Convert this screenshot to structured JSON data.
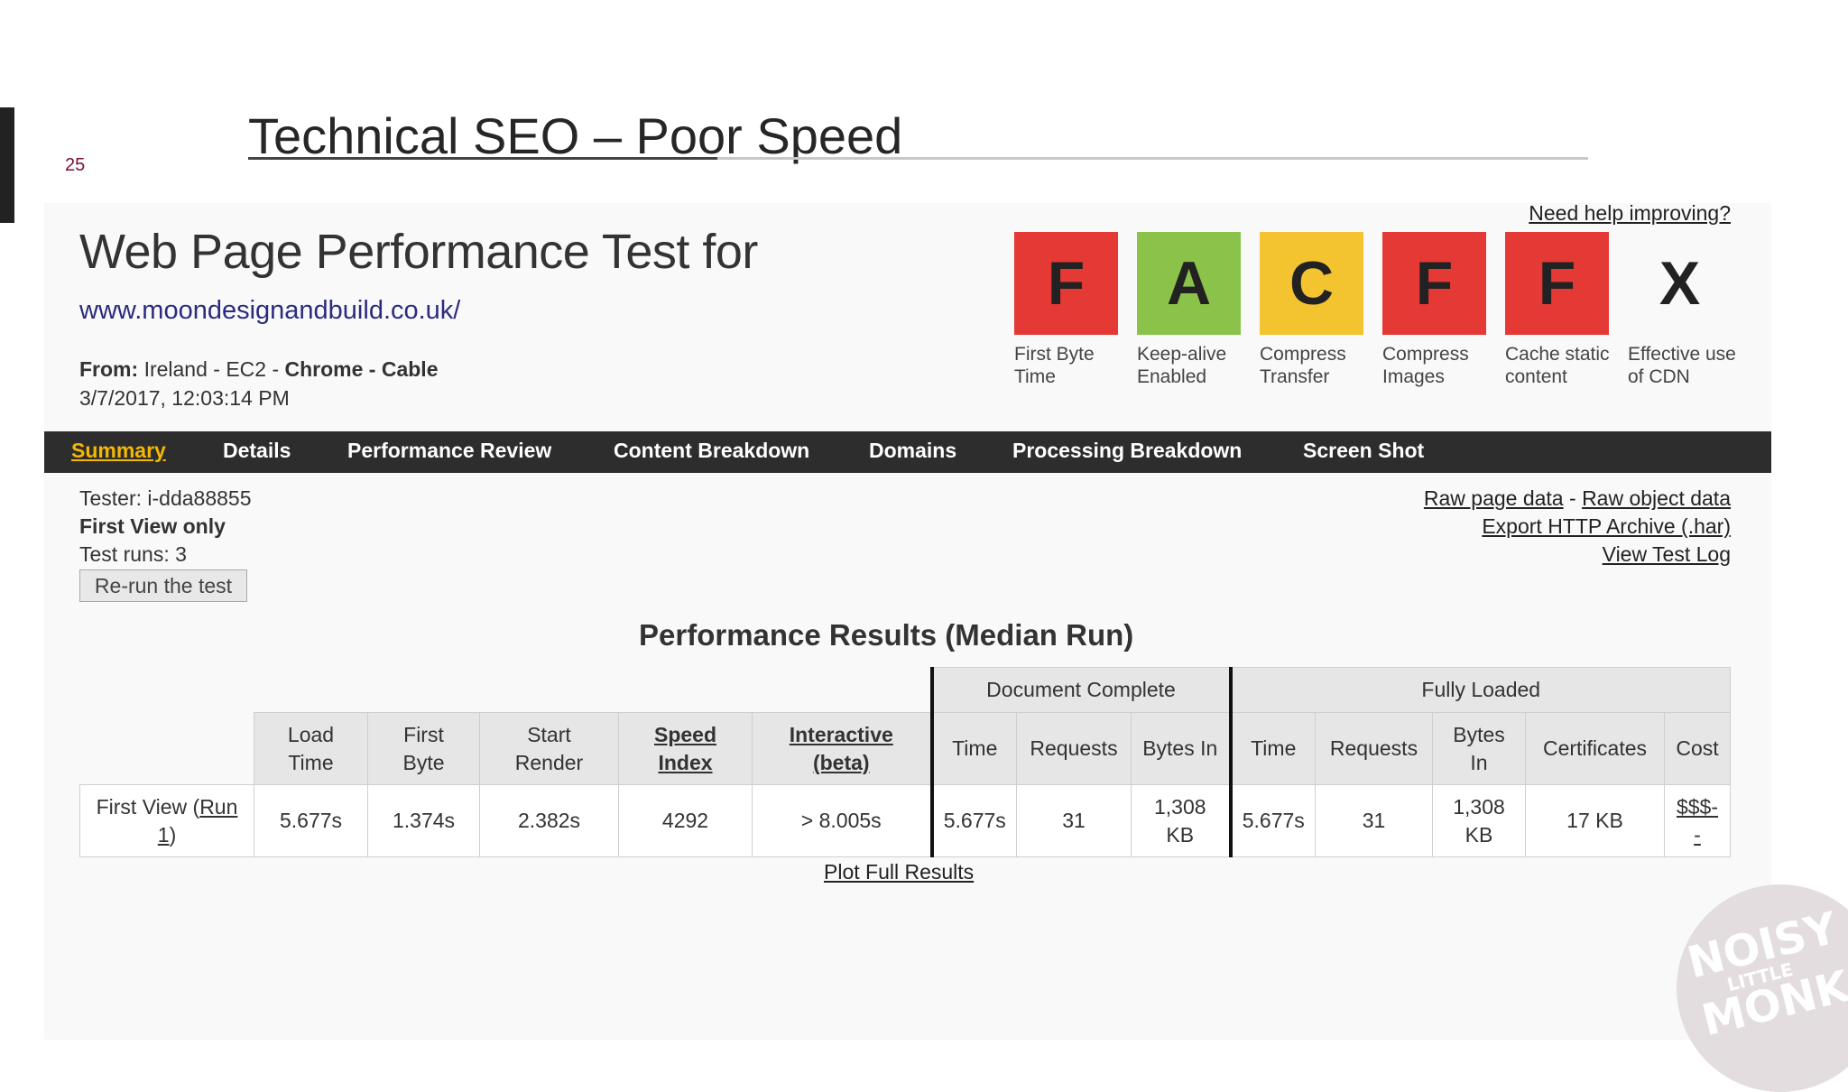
{
  "slide": {
    "number": "25",
    "title": "Technical SEO – Poor Speed"
  },
  "header": {
    "title": "Web Page Performance Test for",
    "url": "www.moondesignandbuild.co.uk/",
    "from_label": "From:",
    "from_value": "Ireland - EC2 - ",
    "from_browser": "Chrome - Cable",
    "date": "3/7/2017, 12:03:14 PM",
    "help_link": "Need help improving?"
  },
  "grades": [
    {
      "grade": "F",
      "label": "First Byte Time",
      "color": "#e53935"
    },
    {
      "grade": "A",
      "label": "Keep-alive Enabled",
      "color": "#8bc34a"
    },
    {
      "grade": "C",
      "label": "Compress Transfer",
      "color": "#f4c430"
    },
    {
      "grade": "F",
      "label": "Compress Images",
      "color": "#e53935"
    },
    {
      "grade": "F",
      "label": "Cache static content",
      "color": "#e53935"
    },
    {
      "grade": "X",
      "label": "Effective use of CDN",
      "color": "#f9f9f9"
    }
  ],
  "nav": {
    "items": [
      "Summary",
      "Details",
      "Performance Review",
      "Content Breakdown",
      "Domains",
      "Processing Breakdown",
      "Screen Shot"
    ],
    "active": "Summary"
  },
  "tester": {
    "tester": "Tester: i-dda88855",
    "view": "First View only",
    "runs": "Test runs: 3",
    "rerun_button": "Re-run the test"
  },
  "links": {
    "raw_page": "Raw page data",
    "separator": " - ",
    "raw_object": "Raw object data",
    "export_har": "Export HTTP Archive (.har)",
    "test_log": "View Test Log"
  },
  "results": {
    "title": "Performance Results (Median Run)",
    "group_document": "Document Complete",
    "group_fully": "Fully Loaded",
    "columns": {
      "load_time": "Load Time",
      "first_byte": "First Byte",
      "start_render": "Start Render",
      "speed_index": "Speed Index",
      "interactive": "Interactive (beta)",
      "doc_time": "Time",
      "doc_requests": "Requests",
      "doc_bytes": "Bytes In",
      "full_time": "Time",
      "full_requests": "Requests",
      "full_bytes": "Bytes In",
      "certificates": "Certificates",
      "cost": "Cost"
    },
    "row": {
      "label_prefix": "First View (",
      "label_link": "Run 1",
      "label_suffix": ")",
      "load_time": "5.677s",
      "first_byte": "1.374s",
      "start_render": "2.382s",
      "speed_index": "4292",
      "interactive": "> 8.005s",
      "doc_time": "5.677s",
      "doc_requests": "31",
      "doc_bytes": "1,308 KB",
      "full_time": "5.677s",
      "full_requests": "31",
      "full_bytes": "1,308 KB",
      "certificates": "17 KB",
      "cost": "$$$-",
      "cost_sub": "-"
    },
    "plot_link": "Plot Full Results"
  },
  "logo": {
    "line1": "NOISY",
    "line2": "LITTLE",
    "line3": "MONKEY"
  }
}
